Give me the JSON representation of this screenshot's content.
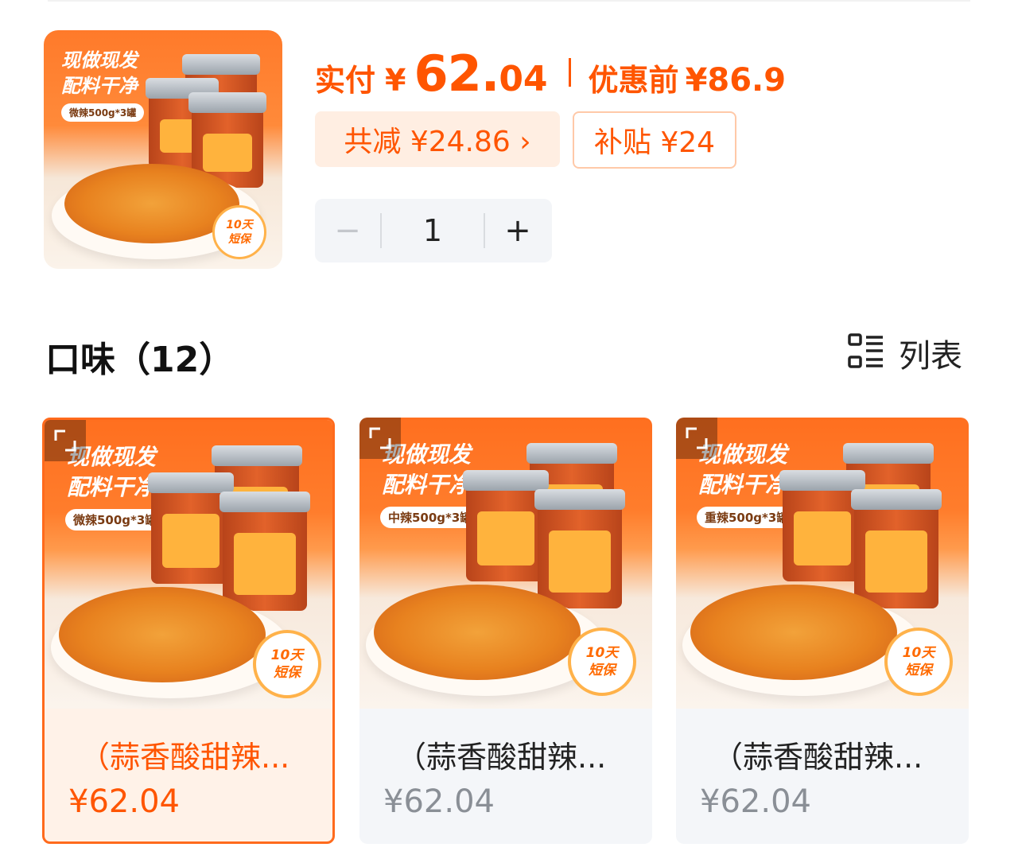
{
  "product": {
    "image_text": {
      "headline_1": "现做现发",
      "headline_2": "配料干净",
      "chip": "微辣500g*3罐",
      "badge_1": "10天",
      "badge_2": "短保"
    },
    "paid_label": "实付",
    "currency": "¥",
    "price_int": "62.",
    "price_dec": "04",
    "orig_label": "优惠前",
    "orig_value": "¥86.9",
    "discount_text": "共减 ¥24.86 ›",
    "subsidy_text": "补贴 ¥24"
  },
  "quantity": {
    "minus": "−",
    "value": "1",
    "plus": "+"
  },
  "flavors": {
    "title": "口味（12）",
    "view_label": "列表",
    "items": [
      {
        "name": "（蒜香酸甜辣...",
        "price": "¥62.04",
        "selected": true,
        "image": {
          "headline_1": "现做现发",
          "headline_2": "配料干净",
          "chip": "微辣500g*3罐",
          "badge_1": "10天",
          "badge_2": "短保"
        }
      },
      {
        "name": "（蒜香酸甜辣...",
        "price": "¥62.04",
        "selected": false,
        "image": {
          "headline_1": "现做现发",
          "headline_2": "配料干净",
          "chip": "中辣500g*3罐",
          "badge_1": "10天",
          "badge_2": "短保"
        }
      },
      {
        "name": "（蒜香酸甜辣...",
        "price": "¥62.04",
        "selected": false,
        "image": {
          "headline_1": "现做现发",
          "headline_2": "配料干净",
          "chip": "重辣500g*3罐",
          "badge_1": "10天",
          "badge_2": "短保"
        }
      }
    ]
  },
  "colors": {
    "accent": "#ff5500",
    "selected_border": "#ff6a1c",
    "card_bg": "#f4f6f9"
  }
}
